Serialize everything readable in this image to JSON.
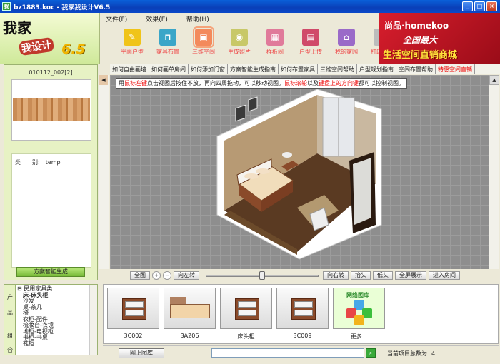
{
  "window": {
    "title": "bz1883.koc - 我家我设计V6.5",
    "app_icon": "我",
    "min_glyph": "_",
    "max_glyph": "□",
    "close_glyph": "×"
  },
  "logo": {
    "line1": "我家",
    "line2": "我设计",
    "version": "6.5"
  },
  "menu": [
    {
      "label": "文件(F)"
    },
    {
      "label": "效果(E)"
    },
    {
      "label": "帮助(H)"
    }
  ],
  "toolbar": [
    {
      "label": "平面户型",
      "icon": "pencil-icon",
      "glyph": "✎",
      "color": "#f0c419"
    },
    {
      "label": "家具布置",
      "icon": "chair-icon",
      "glyph": "⊓",
      "color": "#3aa6c8"
    },
    {
      "label": "三维空间",
      "icon": "cube-icon",
      "glyph": "▣",
      "color": "#f38a5c",
      "active": true
    },
    {
      "label": "生成照片",
      "icon": "camera-icon",
      "glyph": "◉",
      "color": "#c8c868"
    },
    {
      "label": "样板间",
      "icon": "layout-icon",
      "glyph": "▦",
      "color": "#e07a9a"
    },
    {
      "label": "户型上传",
      "icon": "floppy-icon",
      "glyph": "▤",
      "color": "#d04a6a"
    },
    {
      "label": "我的家园",
      "icon": "house-icon",
      "glyph": "⌂",
      "color": "#9a6ac8"
    },
    {
      "label": "打印图片",
      "icon": "printer-icon",
      "glyph": "⎙",
      "color": "#bcbcbc"
    }
  ],
  "ad": {
    "brand": "尚品·homekoo",
    "slogan1": "全国最大",
    "slogan2": "生活空间直销商城"
  },
  "material": {
    "title": "010112_002[2]",
    "property_key": "类　　别:",
    "property_value": "temp"
  },
  "generate_button": "方案智能生成",
  "helplinks": [
    {
      "label": "如何自由画墙"
    },
    {
      "label": "如何画单房间"
    },
    {
      "label": "如何添加门窗"
    },
    {
      "label": "方案智能生成指南"
    },
    {
      "label": "如何布置家具"
    },
    {
      "label": "三维空间帮助"
    },
    {
      "label": "户型规划指南"
    },
    {
      "label": "空间布置帮助"
    },
    {
      "label": "特惠空间直销",
      "red": true
    }
  ],
  "hint": {
    "p1": "用",
    "p2": "鼠标左键",
    "p3": "点击视图后按住不放，再向四周拖动，可以移动视图。",
    "p4": "鼠标滚轮",
    "p5": "以及",
    "p6": "键盘上的方向键",
    "p7": "都可以控制视图。"
  },
  "controls": {
    "full": "全图",
    "zoom_in": "+",
    "zoom_out": "−",
    "rotate_left": "向左转",
    "rotate_right": "向右转",
    "look_up": "抬头",
    "look_down": "低头",
    "fullscreen": "全屏展示",
    "enter_room": "进入房间",
    "slider_level": 0.5
  },
  "scroll_up": "▲",
  "scroll_left": "◀",
  "tree": {
    "tabs": [
      {
        "label": "产"
      },
      {
        "label": "品"
      },
      {
        "label": "组"
      },
      {
        "label": "合"
      }
    ],
    "items": [
      {
        "label": "⊟ 民用家具类",
        "sel": false
      },
      {
        "label": "　床-床头柜",
        "sel": true
      },
      {
        "label": "　沙发",
        "sel": false
      },
      {
        "label": "　桌-茶几",
        "sel": false
      },
      {
        "label": "　椅",
        "sel": false
      },
      {
        "label": "　衣柜-配件",
        "sel": false
      },
      {
        "label": "　梳妆台-衣镜",
        "sel": false
      },
      {
        "label": "　地柜-电视柜",
        "sel": false
      },
      {
        "label": "　书柜-书桌",
        "sel": false
      },
      {
        "label": "　鞋柜",
        "sel": false
      }
    ]
  },
  "thumbnails": [
    {
      "caption": "3C002",
      "kind": "nightstand"
    },
    {
      "caption": "3A206",
      "kind": "bed"
    },
    {
      "caption": "床头柜",
      "kind": "nightstand"
    },
    {
      "caption": "3C009",
      "kind": "nightstand"
    },
    {
      "caption": "更多...",
      "kind": "more",
      "label": "网络图库"
    }
  ],
  "bottom": {
    "online_button": "网上图库",
    "search_value": "",
    "search_glyph": "⌕",
    "count_label": "当前项目总数为",
    "count_value": "4"
  }
}
